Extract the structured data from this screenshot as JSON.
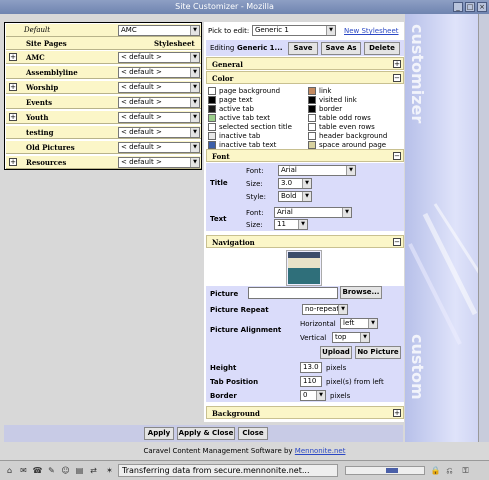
{
  "window": {
    "title": "Site Customizer - Mozilla"
  },
  "left": {
    "default_label": "Default",
    "default_value": "AMC",
    "col_pages": "Site Pages",
    "col_stylesheet": "Stylesheet",
    "pages": [
      {
        "label": "AMC",
        "expand": true,
        "value": "< default >"
      },
      {
        "label": "Assemblyline",
        "expand": false,
        "value": "< default >"
      },
      {
        "label": "Worship",
        "expand": true,
        "value": "< default >"
      },
      {
        "label": "Events",
        "expand": false,
        "value": "< default >"
      },
      {
        "label": "Youth",
        "expand": true,
        "value": "< default >"
      },
      {
        "label": "testing",
        "expand": false,
        "value": "< default >"
      },
      {
        "label": "Old Pictures",
        "expand": false,
        "value": "< default >"
      },
      {
        "label": "Resources",
        "expand": true,
        "value": "< default >"
      }
    ]
  },
  "editor": {
    "pick_label": "Pick to edit:",
    "pick_value": "Generic 1",
    "new_link": "New Stylesheet",
    "editing_prefix": "Editing",
    "editing_name": "Generic 1...",
    "save": "Save",
    "save_as": "Save As",
    "delete": "Delete"
  },
  "sections": {
    "general": "General",
    "color": "Color",
    "font": "Font",
    "navigation": "Navigation",
    "background": "Background",
    "toggle_plus": "+",
    "toggle_minus": "−"
  },
  "colors": {
    "left": [
      {
        "label": "page background",
        "color": "#ffffff"
      },
      {
        "label": "page text",
        "color": "#000000"
      },
      {
        "label": "active tab",
        "color": "#1a1a1a"
      },
      {
        "label": "active tab text",
        "color": "#9ccf8c"
      },
      {
        "label": "selected section title",
        "color": "#ffffff"
      },
      {
        "label": "inactive tab",
        "color": "#e8e8e8"
      },
      {
        "label": "inactive tab text",
        "color": "#3c5ea8"
      }
    ],
    "right": [
      {
        "label": "link",
        "color": "#c48a60"
      },
      {
        "label": "visited link",
        "color": "#000000"
      },
      {
        "label": "border",
        "color": "#000000"
      },
      {
        "label": "table odd rows",
        "color": "#ffffff"
      },
      {
        "label": "table even rows",
        "color": "#ffffff"
      },
      {
        "label": "header background",
        "color": "#ffffff"
      },
      {
        "label": "space around page",
        "color": "#d8d2a0"
      }
    ]
  },
  "font": {
    "title_label": "Title",
    "text_label": "Text",
    "font_label": "Font:",
    "size_label": "Size:",
    "style_label": "Style:",
    "title_font": "Arial",
    "title_size": "3.0",
    "title_style": "Bold",
    "text_font": "Arial",
    "text_size": "11"
  },
  "navigation": {
    "picture_label": "Picture",
    "browse": "Browse...",
    "repeat_label": "Picture Repeat",
    "repeat_value": "no-repeat",
    "align_label": "Picture Alignment",
    "horizontal_label": "Horizontal",
    "horizontal_value": "left",
    "vertical_label": "Vertical",
    "vertical_value": "top",
    "upload": "Upload",
    "no_picture": "No Picture",
    "height_label": "Height",
    "height_value": "13.0",
    "height_unit": "pixels",
    "tabpos_label": "Tab Position",
    "tabpos_value": "110",
    "tabpos_unit": "pixel(s) from left",
    "border_label": "Border",
    "border_value": "0",
    "border_unit": "pixels"
  },
  "bottom": {
    "apply": "Apply",
    "apply_close": "Apply & Close",
    "close": "Close"
  },
  "footer": {
    "text": "Caravel Content Management Software by ",
    "link": "Mennonite.net"
  },
  "status": {
    "text": "Transferring data from secure.mennonite.net..."
  },
  "watermark": {
    "top": "customizer",
    "bottom": "custom"
  }
}
